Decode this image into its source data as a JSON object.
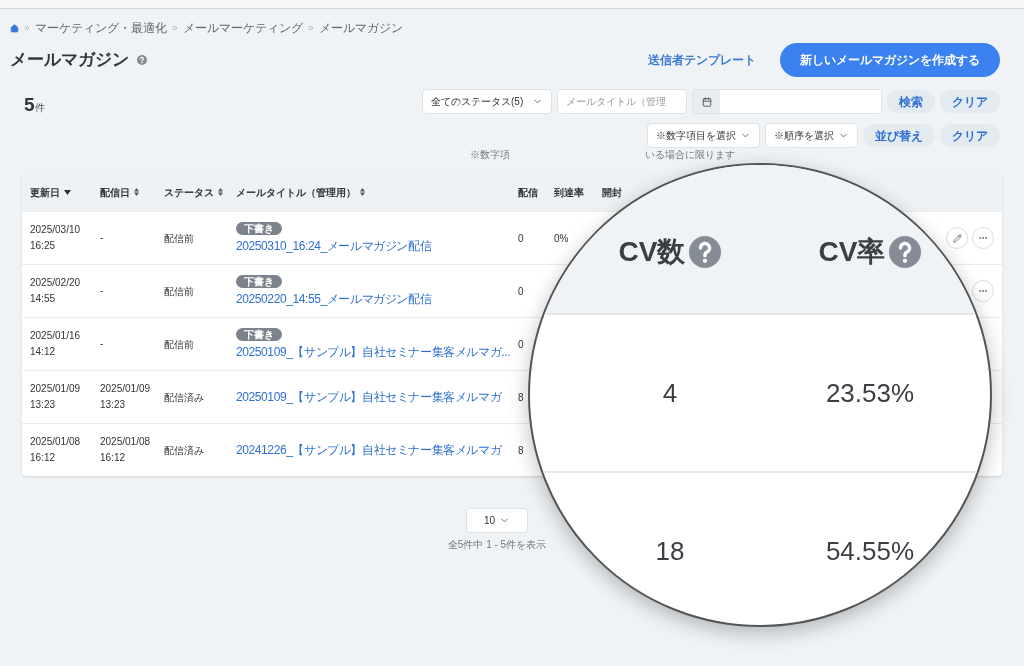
{
  "breadcrumb": {
    "items": [
      "マーケティング・最適化",
      "メールマーケティング",
      "メールマガジン"
    ]
  },
  "page": {
    "title": "メールマガジン",
    "sender_template_link": "送信者テンプレート",
    "create_button": "新しいメールマガジンを作成する"
  },
  "count": {
    "number": "5",
    "unit": "件"
  },
  "filters": {
    "status_select": "全てのステータス(5)",
    "title_field": {
      "placeholder": "メールタイトル（管理"
    },
    "search_button": "検索",
    "clear_button": "クリア"
  },
  "sort": {
    "field_select": "※数字項目を選択",
    "order_select": "※順序を選択",
    "sort_button": "並び替え",
    "clear_button": "クリア",
    "hint_start": "※数字項",
    "hint_end": "いる場合に限ります"
  },
  "table": {
    "columns": [
      {
        "label": "更新日",
        "sortable": true,
        "sorted": true
      },
      {
        "label": "配信日",
        "sortable": true,
        "sorted": false
      },
      {
        "label": "ステータス",
        "sortable": true,
        "sorted": false
      },
      {
        "label": "メールタイトル（管理用）",
        "sortable": true,
        "sorted": false
      },
      {
        "label": "配信",
        "sortable": false
      },
      {
        "label": "到達率",
        "sortable": false
      },
      {
        "label": "開封",
        "sortable": false
      }
    ],
    "rows": [
      {
        "updated_date": "2025/03/10",
        "updated_time": "16:25",
        "sent_date": "-",
        "status": "配信前",
        "badge": "下書き",
        "title": "20250310_16:24_メールマガジン配信",
        "delivered": "0",
        "reach": "0%",
        "actions": true,
        "edit": true
      },
      {
        "updated_date": "2025/02/20",
        "updated_time": "14:55",
        "sent_date": "-",
        "status": "配信前",
        "badge": "下書き",
        "title": "20250220_14:55_メールマガジン配信",
        "delivered": "0",
        "actions": true,
        "edit": false
      },
      {
        "updated_date": "2025/01/16",
        "updated_time": "14:12",
        "sent_date": "-",
        "status": "配信前",
        "badge": "下書き",
        "title": "20250109_【サンプル】自社セミナー集客メルマガ...",
        "delivered": "0",
        "actions": false
      },
      {
        "updated_date": "2025/01/09",
        "updated_time": "13:23",
        "sent_date": "2025/01/09",
        "sent_time": "13:23",
        "status": "配信済み",
        "title": "20250109_【サンプル】自社セミナー集客メルマガ",
        "delivered": "8",
        "actions": false
      },
      {
        "updated_date": "2025/01/08",
        "updated_time": "16:12",
        "sent_date": "2025/01/08",
        "sent_time": "16:12",
        "status": "配信済み",
        "title": "20241226_【サンプル】自社セミナー集客メルマガ",
        "delivered": "8",
        "actions": false
      }
    ]
  },
  "pagination": {
    "per_page": "10",
    "summary": "全5件中 1 - 5件を表示"
  },
  "magnifier": {
    "columns": [
      "CV数",
      "CV率"
    ],
    "rows": [
      [
        "4",
        "23.53%"
      ],
      [
        "18",
        "54.55%"
      ]
    ]
  }
}
